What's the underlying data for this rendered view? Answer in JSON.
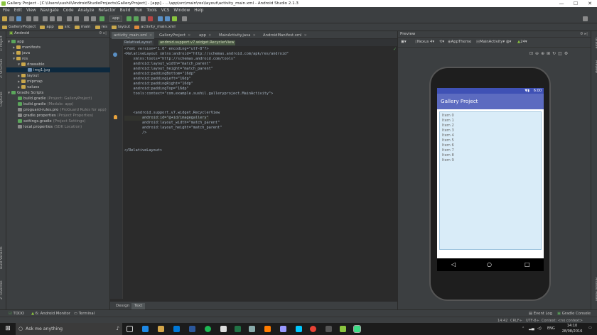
{
  "window": {
    "title": "Gallery Project - [C:\\Users\\sushil\\AndroidStudioProjects\\GalleryProject] - [app] - ...\\app\\src\\main\\res\\layout\\activity_main.xml - Android Studio 2.1.3",
    "minimize": "—",
    "maximize": "☐",
    "close": "✕"
  },
  "menu": [
    "File",
    "Edit",
    "View",
    "Navigate",
    "Code",
    "Analyze",
    "Refactor",
    "Build",
    "Run",
    "Tools",
    "VCS",
    "Window",
    "Help"
  ],
  "toolbar": {
    "run_config": "app"
  },
  "navbar": {
    "crumbs": [
      "GalleryProject",
      "app",
      "src",
      "main",
      "res",
      "layout",
      "activity_main.xml"
    ]
  },
  "left_strip": {
    "tabs": [
      "1: Project",
      "2: Structure",
      "Captures",
      "Build Variants",
      "2: Favorites"
    ]
  },
  "project_panel": {
    "view_mode": "Android",
    "tree": [
      {
        "label": "app",
        "hint": ""
      },
      {
        "label": "manifests",
        "hint": ""
      },
      {
        "label": "java",
        "hint": ""
      },
      {
        "label": "res",
        "hint": ""
      },
      {
        "label": "drawable",
        "hint": ""
      },
      {
        "label": "img1.jpg",
        "hint": ""
      },
      {
        "label": "layout",
        "hint": ""
      },
      {
        "label": "mipmap",
        "hint": ""
      },
      {
        "label": "values",
        "hint": ""
      },
      {
        "label": "Gradle Scripts",
        "hint": ""
      },
      {
        "label": "build.gradle",
        "hint": "(Project: GalleryProject)"
      },
      {
        "label": "build.gradle",
        "hint": "(Module: app)"
      },
      {
        "label": "proguard-rules.pro",
        "hint": "(ProGuard Rules for app)"
      },
      {
        "label": "gradle.properties",
        "hint": "(Project Properties)"
      },
      {
        "label": "settings.gradle",
        "hint": "(Project Settings)"
      },
      {
        "label": "local.properties",
        "hint": "(SDK Location)"
      }
    ]
  },
  "editor": {
    "tabs": [
      "activity_main.xml",
      "GalleryProject",
      "app",
      "MainActivity.java",
      "AndroidManifest.xml"
    ],
    "breadcrumbs": [
      "RelativeLayout",
      "android.support.v7.widget.RecyclerView"
    ],
    "lines": [
      "<?xml version=\"1.0\" encoding=\"utf-8\"?>",
      "<RelativeLayout xmlns:android=\"http://schemas.android.com/apk/res/android\"",
      "    xmlns:tools=\"http://schemas.android.com/tools\"",
      "    android:layout_width=\"match_parent\"",
      "    android:layout_height=\"match_parent\"",
      "    android:paddingBottom=\"16dp\"",
      "    android:paddingLeft=\"16dp\"",
      "    android:paddingRight=\"16dp\"",
      "    android:paddingTop=\"16dp\"",
      "    tools:context=\"com.example.sushil.galleryproject.MainActivity\">",
      "",
      "",
      "    <android.support.v7.widget.RecyclerView",
      "        android:id=\"@+id/imagegallery\"",
      "        android:layout_width=\"match_parent\"",
      "        android:layout_height=\"match_parent\"",
      "        />",
      "",
      "",
      "</RelativeLayout>"
    ],
    "design_tabs": [
      "Design",
      "Text"
    ]
  },
  "preview": {
    "title": "Preview",
    "device": "Nexus 4",
    "theme": "AppTheme",
    "activity": "MainActivity",
    "api": "24",
    "phone": {
      "time": "6:00",
      "app_title": "Gallery Project",
      "items": [
        "Item 0",
        "Item 1",
        "Item 2",
        "Item 3",
        "Item 4",
        "Item 5",
        "Item 6",
        "Item 7",
        "Item 8",
        "Item 9"
      ]
    }
  },
  "right_strip": {
    "tabs": [
      "Gradle",
      "Preview",
      "Android Model"
    ]
  },
  "bottom_tools": {
    "left": [
      "TODO",
      "6: Android Monitor",
      "Terminal"
    ],
    "right": [
      "Event Log",
      "Gradle Console"
    ]
  },
  "status": {
    "position": "14:42",
    "line_sep": "CRLF÷",
    "encoding": "UTF-8÷",
    "context": "Context: <no context>"
  },
  "taskbar": {
    "search_placeholder": "Ask me anything",
    "lang": "ENG",
    "time": "14:10",
    "date": "28/08/2016"
  },
  "colors": {
    "accent": "#3f51b5",
    "app_bar": "#5c6bc0",
    "ide_bg": "#2b2b2b",
    "panel_bg": "#3c3f41"
  }
}
